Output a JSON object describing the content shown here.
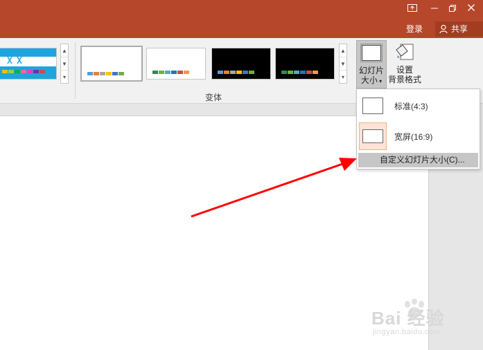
{
  "window": {
    "controls": [
      "ribbon-display-icon",
      "minimize-icon",
      "restore-icon",
      "close-icon"
    ],
    "accent_color": "#B7472A"
  },
  "header": {
    "login_label": "登录",
    "share_label": "共享"
  },
  "ribbon": {
    "variants_group_label": "变体",
    "slide_size_label_line1": "幻灯片",
    "slide_size_label_line2": "大小",
    "bg_format_label_line1": "设置",
    "bg_format_label_line2": "背景格式",
    "variant_swatch_colors": [
      "#5B9BD5",
      "#ED7D31",
      "#A5A5A5",
      "#FFC000",
      "#4472C4",
      "#70AD47"
    ],
    "variant_swatch_colors_alt": [
      "#2E8B57",
      "#70AD47",
      "#4BACC6",
      "#1F77B4",
      "#C0504D",
      "#F79646"
    ],
    "theme_swatch_colors": [
      "#FFC000",
      "#92D050",
      "#00B050",
      "#FF6699",
      "#FF33CC",
      "#7030A0",
      "#C0504D"
    ]
  },
  "dropdown": {
    "items": [
      {
        "label": "标准(4:3)"
      },
      {
        "label": "宽屏(16:9)"
      }
    ],
    "custom_label": "自定义幻灯片大小(C)..."
  },
  "watermark": {
    "main": "Bai 经验",
    "sub": "jingyan.baidu.com"
  },
  "annotation_color": "#FF0000"
}
